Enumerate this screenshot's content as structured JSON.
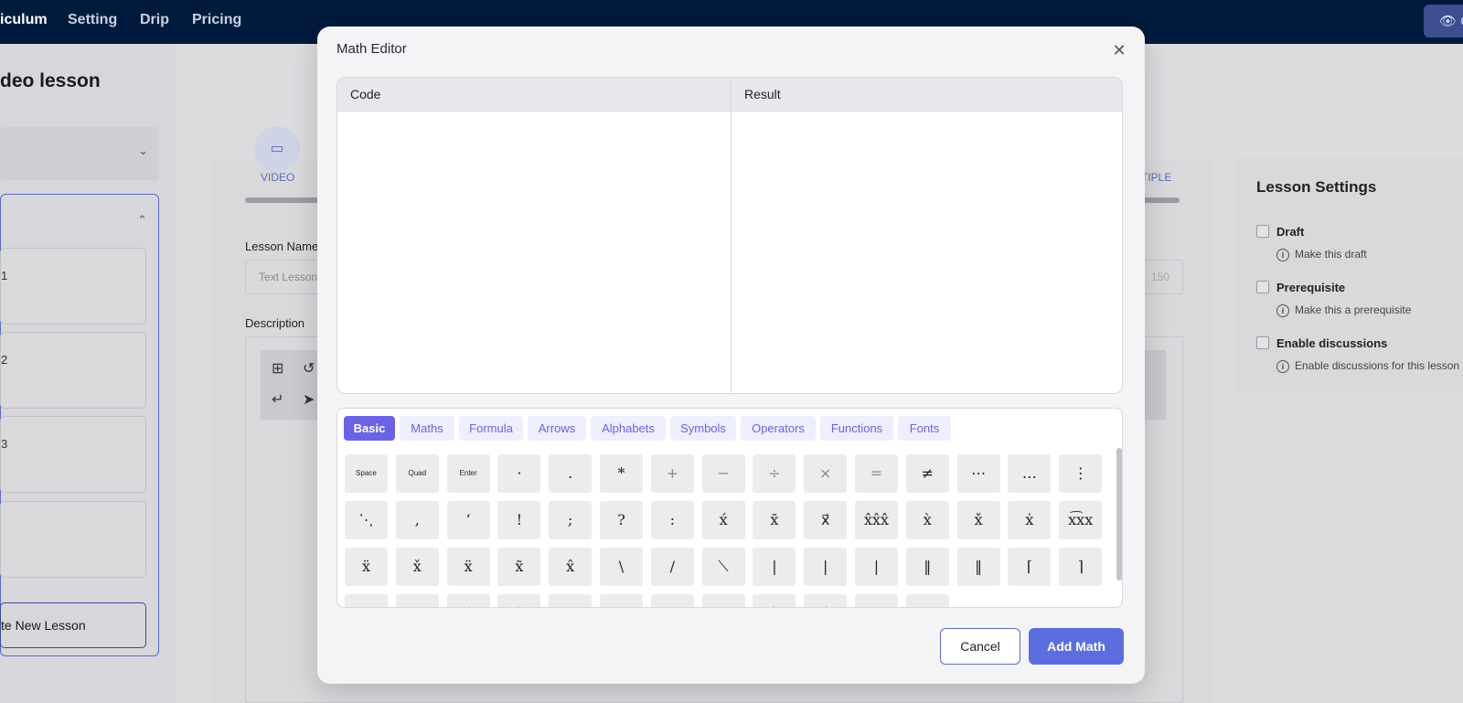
{
  "nav": {
    "items": [
      "iculum",
      "Setting",
      "Drip",
      "Pricing"
    ],
    "preview_label": "C",
    "preview_icon": "eye-icon"
  },
  "background": {
    "page_title": "deo lesson",
    "lessons": [
      "1",
      "2",
      "3",
      ""
    ],
    "create_lesson": "te New Lesson",
    "tab_video": "VIDEO",
    "tab_multiple": "TIPLE",
    "lesson_name_label": "Lesson Name",
    "lesson_name_value": "Text Lesson",
    "lesson_name_count": "150",
    "description_label": "Description"
  },
  "settings": {
    "title": "Lesson Settings",
    "options": [
      {
        "label": "Draft",
        "hint": "Make this draft"
      },
      {
        "label": "Prerequisite",
        "hint": "Make this a prerequisite"
      },
      {
        "label": "Enable discussions",
        "hint": "Enable discussions for this lesson"
      }
    ]
  },
  "modal": {
    "title": "Math Editor",
    "close_icon": "close-icon",
    "code_header": "Code",
    "result_header": "Result",
    "tabs": [
      "Basic",
      "Maths",
      "Formula",
      "Arrows",
      "Alphabets",
      "Symbols",
      "Operators",
      "Functions",
      "Fonts"
    ],
    "active_tab": "Basic",
    "symbols": [
      [
        "Space",
        "Quad",
        "Enter",
        "·",
        ".",
        "*",
        "+",
        "−",
        "÷",
        "×",
        "=",
        "≠",
        "⋯",
        "…",
        "⋮"
      ],
      [
        "⋱",
        ",",
        "‘",
        "!",
        ";",
        "?",
        ":",
        "x́",
        "x̄",
        "x⃗",
        "x̂x̂x̂",
        "x̀",
        "x̌",
        "ẋ",
        "x͡xx"
      ],
      [
        "ẍ",
        "x̌",
        "ẍ",
        "x̃",
        "x̂",
        "\\",
        "/",
        "⟍",
        "|",
        "|",
        "|",
        "‖",
        "‖",
        "⌈",
        "⌉"
      ],
      [
        "[",
        "]",
        "⟨",
        "⟩",
        "(",
        ")",
        "{",
        "}",
        "⌊",
        "⌋",
        "|",
        "|"
      ]
    ],
    "cancel_label": "Cancel",
    "add_label": "Add Math"
  }
}
